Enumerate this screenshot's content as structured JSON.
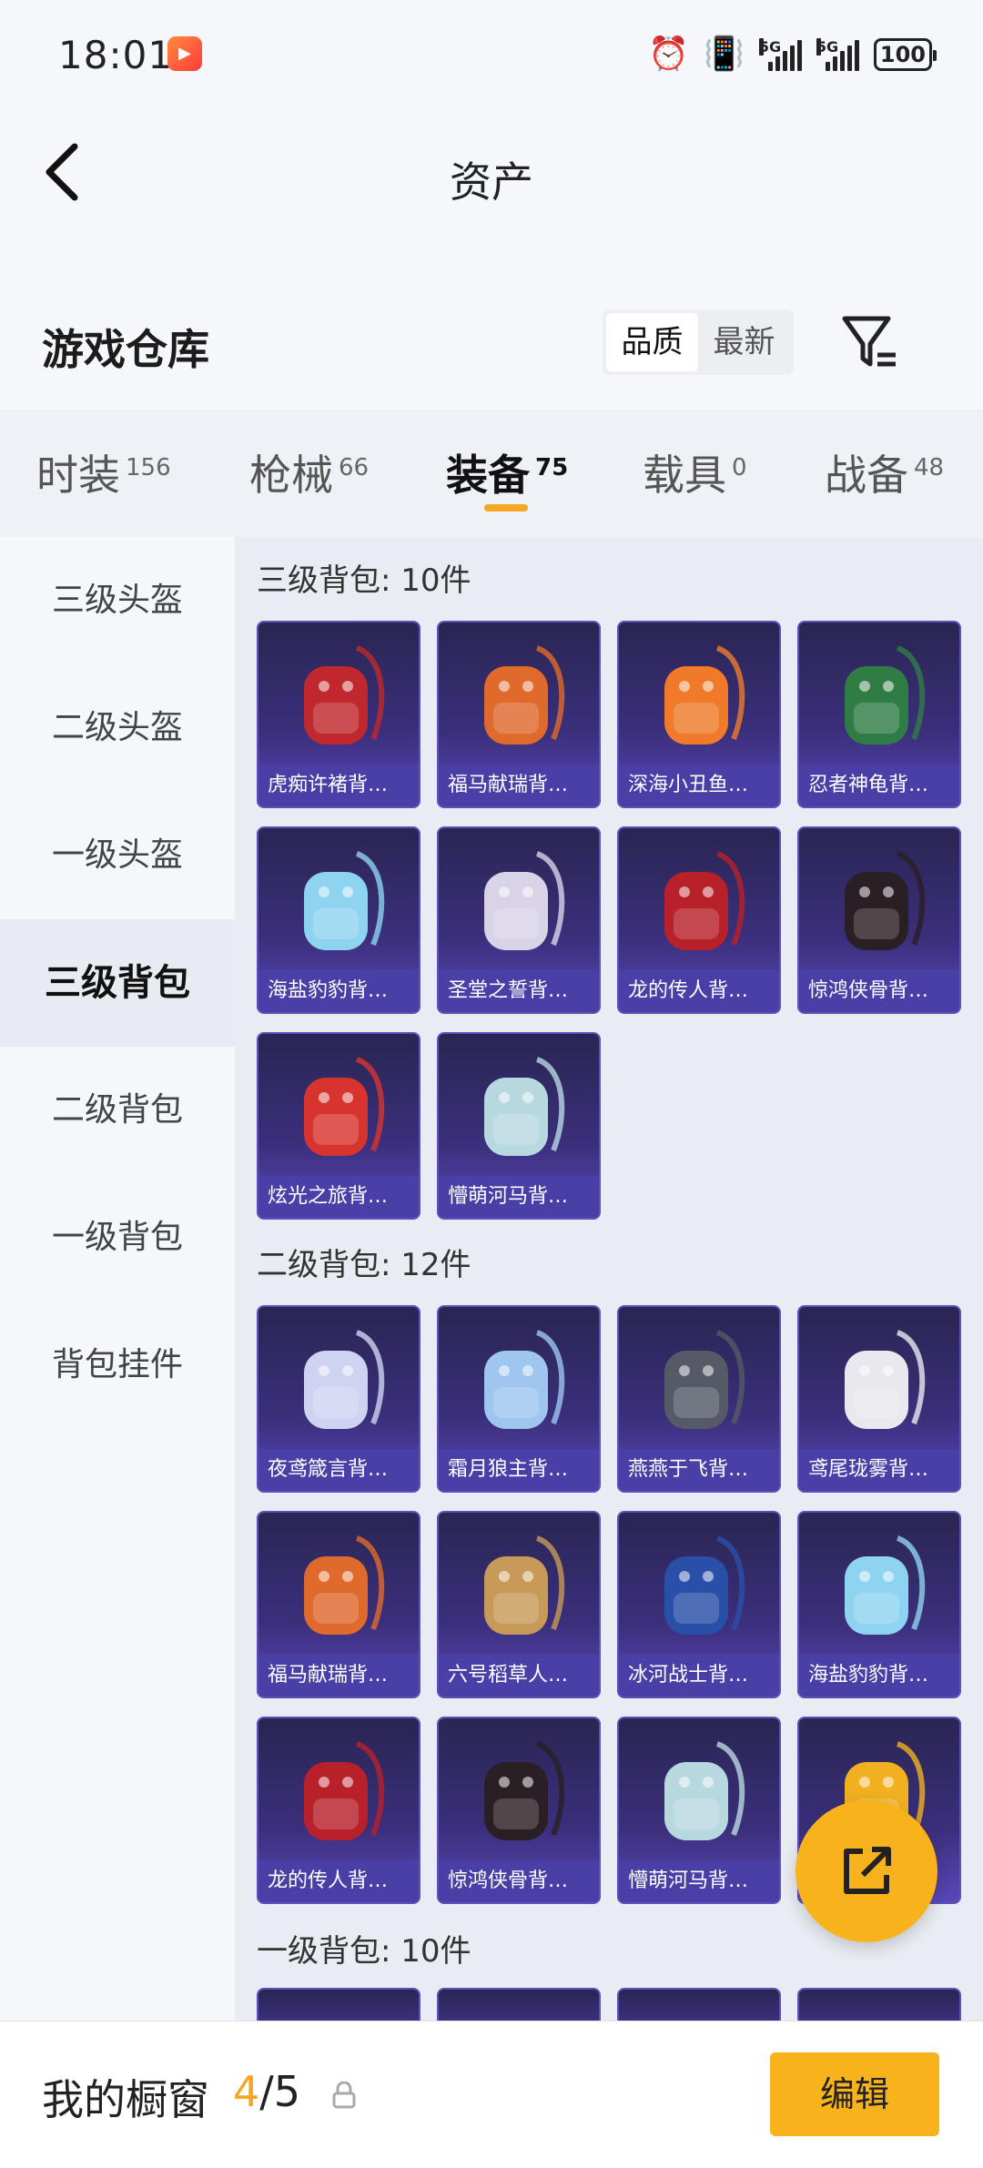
{
  "status_bar": {
    "time": "18:01",
    "app_icon": "kuaishou-icon",
    "icons": [
      "alarm-icon",
      "vibrate-icon",
      "signal-5g-icon",
      "signal-5g-icon",
      "battery-icon"
    ],
    "signal_label": "5G",
    "battery": "100"
  },
  "header": {
    "title": "资产",
    "back_icon": "back-arrow-icon"
  },
  "warehouse": {
    "title": "游戏仓库",
    "sort_options": [
      "品质",
      "最新"
    ],
    "sort_selected": "品质",
    "filter_icon": "filter-icon"
  },
  "tabs": [
    {
      "label": "时装",
      "count": "156"
    },
    {
      "label": "枪械",
      "count": "66"
    },
    {
      "label": "装备",
      "count": "75"
    },
    {
      "label": "载具",
      "count": "0"
    },
    {
      "label": "战备",
      "count": "48"
    }
  ],
  "active_tab": "装备",
  "sidebar": [
    {
      "label": "三级头盔"
    },
    {
      "label": "二级头盔"
    },
    {
      "label": "一级头盔"
    },
    {
      "label": "三级背包"
    },
    {
      "label": "二级背包"
    },
    {
      "label": "一级背包"
    },
    {
      "label": "背包挂件"
    }
  ],
  "active_sidebar": "三级背包",
  "sections": [
    {
      "title": "三级背包: 10件",
      "items": [
        {
          "label": "虎痴许褚背…",
          "color": "#c0282d"
        },
        {
          "label": "福马献瑞背…",
          "color": "#e06a2c"
        },
        {
          "label": "深海小丑鱼…",
          "color": "#f07a2a"
        },
        {
          "label": "忍者神龟背…",
          "color": "#2f7d45"
        },
        {
          "label": "海盐豹豹背…",
          "color": "#8ed3f0"
        },
        {
          "label": "圣堂之誓背…",
          "color": "#d9d3e8"
        },
        {
          "label": "龙的传人背…",
          "color": "#b8202a"
        },
        {
          "label": "惊鸿侠骨背…",
          "color": "#2a1f24"
        },
        {
          "label": "炫光之旅背…",
          "color": "#d8342f"
        },
        {
          "label": "懵萌河马背…",
          "color": "#b8d8e0"
        }
      ]
    },
    {
      "title": "二级背包: 12件",
      "items": [
        {
          "label": "夜鸢箴言背…",
          "color": "#cfd3f2"
        },
        {
          "label": "霜月狼主背…",
          "color": "#9ec6ee"
        },
        {
          "label": "燕燕于飞背…",
          "color": "#555a66"
        },
        {
          "label": "鸢尾珑雾背…",
          "color": "#e8e8ee"
        },
        {
          "label": "福马献瑞背…",
          "color": "#e06a2c"
        },
        {
          "label": "六号稻草人…",
          "color": "#c79a58"
        },
        {
          "label": "冰河战士背…",
          "color": "#2a4fa8"
        },
        {
          "label": "海盐豹豹背…",
          "color": "#8ed3f0"
        },
        {
          "label": "龙的传人背…",
          "color": "#b8202a"
        },
        {
          "label": "惊鸿侠骨背…",
          "color": "#2a1f24"
        },
        {
          "label": "懵萌河马背…",
          "color": "#b8d8e0"
        },
        {
          "label": "",
          "color": "#f0b020"
        }
      ]
    },
    {
      "title": "一级背包: 10件",
      "items": []
    }
  ],
  "fab_icon": "share-external-icon",
  "bottom_bar": {
    "label": "我的橱窗",
    "current": "4",
    "separator": "/",
    "total": "5",
    "lock_icon": "lock-icon",
    "edit_label": "编辑"
  },
  "colors": {
    "accent": "#f7b21c",
    "card_bg": "#3b2f7c",
    "card_label_bg": "#4a3fa6"
  }
}
